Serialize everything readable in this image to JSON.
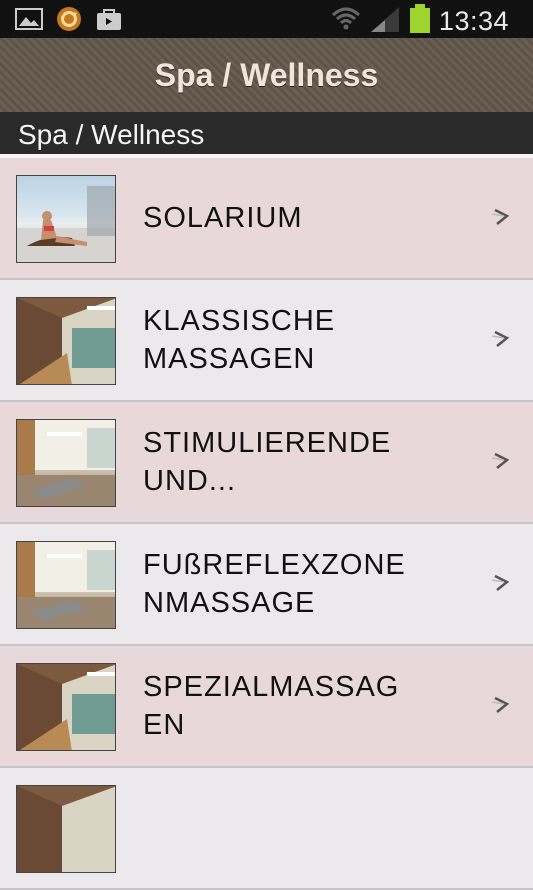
{
  "status_bar": {
    "time": "13:34",
    "icons": [
      "picture-icon",
      "sync-icon",
      "bag-icon",
      "wifi-icon",
      "signal-icon",
      "battery-icon"
    ]
  },
  "app_bar": {
    "title": "Spa / Wellness"
  },
  "section": {
    "label": "Spa / Wellness"
  },
  "list": {
    "items": [
      {
        "label": "SOLARIUM",
        "thumb": "solarium-photo"
      },
      {
        "label": "KLASSISCHE\nMASSAGEN",
        "thumb": "pool-photo"
      },
      {
        "label": "STIMULIERENDE\nUND...",
        "thumb": "relax-room-photo"
      },
      {
        "label": "FUßREFLEXZONE\nNMASSAGE",
        "thumb": "relax-room-photo"
      },
      {
        "label": "SPEZIALMASSAG\nEN",
        "thumb": "pool-photo"
      },
      {
        "label": "",
        "thumb": "pool-photo"
      }
    ]
  },
  "colors": {
    "status_bg": "#111111",
    "header_bg": "#645849",
    "section_bg": "#2a2a2a",
    "row_alt": "#e8d8da",
    "row_plain": "#ebe9ec",
    "battery": "#9ed42d"
  }
}
